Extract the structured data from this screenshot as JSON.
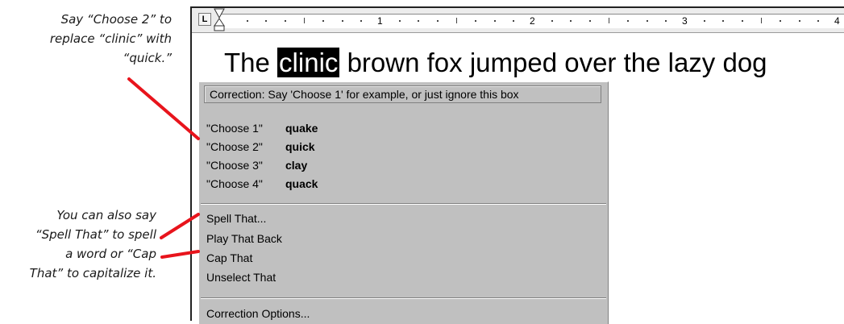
{
  "callouts": {
    "choose": {
      "lines": [
        "Say “Choose 2” to",
        "replace “clinic” with",
        "“quick.”"
      ]
    },
    "spell": {
      "lines": [
        "You can also say",
        "“Spell That” to spell",
        "a word or “Cap",
        "That” to capitalize it."
      ]
    }
  },
  "colors": {
    "callout_line": "#e8141c",
    "selection": "#000000",
    "menu_bg": "#c0c0c0"
  },
  "ruler": {
    "tab_stop_label": "L",
    "numbers": [
      "1",
      "2",
      "3",
      "4"
    ]
  },
  "document": {
    "before": "The",
    "selected": "clinic",
    "after": "brown fox jumped over the lazy dog"
  },
  "correction_menu": {
    "title": "Correction: Say 'Choose 1' for example, or just ignore this box",
    "choices": [
      {
        "command": "\"Choose 1\"",
        "word": "quake"
      },
      {
        "command": "\"Choose 2\"",
        "word": "quick"
      },
      {
        "command": "\"Choose 3\"",
        "word": "clay"
      },
      {
        "command": "\"Choose 4\"",
        "word": "quack"
      }
    ],
    "commands": [
      "Spell That...",
      "Play That Back",
      "Cap That",
      "Unselect That"
    ],
    "options": "Correction Options..."
  }
}
